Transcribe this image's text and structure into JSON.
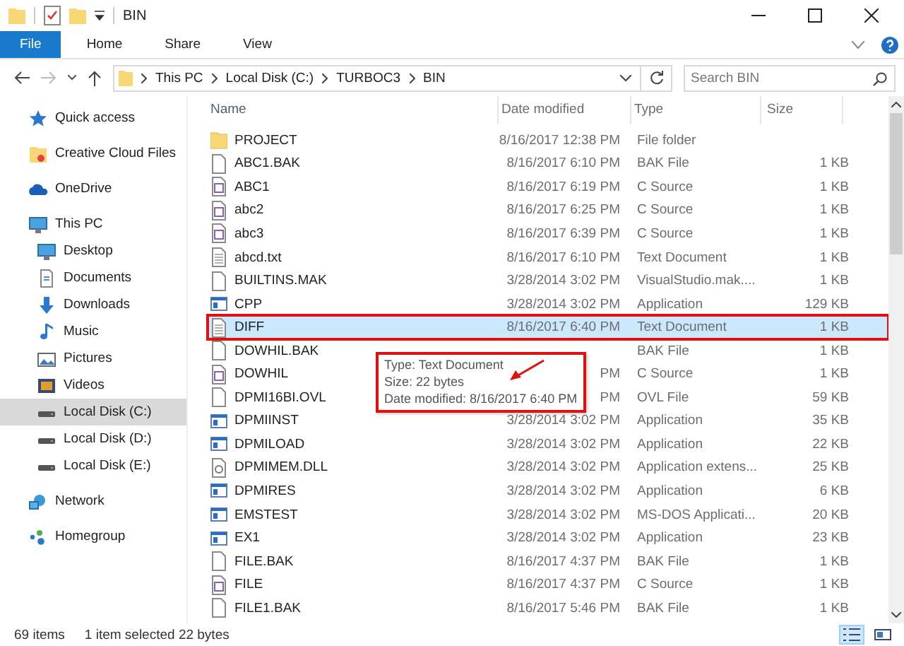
{
  "window": {
    "title": "BIN"
  },
  "ribbon": {
    "tabs": [
      {
        "label": "File",
        "selected": true
      },
      {
        "label": "Home",
        "selected": false
      },
      {
        "label": "Share",
        "selected": false
      },
      {
        "label": "View",
        "selected": false
      }
    ]
  },
  "address": {
    "crumbs": [
      "This PC",
      "Local Disk (C:)",
      "TURBOC3",
      "BIN"
    ],
    "search": {
      "placeholder": "Search BIN"
    }
  },
  "sidebar": {
    "items": [
      {
        "label": "Quick access",
        "kind": "star",
        "selected": false
      },
      {
        "label": "Creative Cloud Files",
        "kind": "cloudfolder",
        "selected": false
      },
      {
        "label": "OneDrive",
        "kind": "cloud",
        "selected": false
      },
      {
        "label": "This PC",
        "kind": "pc",
        "selected": false,
        "children": [
          {
            "label": "Desktop",
            "kind": "desktop",
            "selected": false
          },
          {
            "label": "Documents",
            "kind": "docs",
            "selected": false
          },
          {
            "label": "Downloads",
            "kind": "download",
            "selected": false
          },
          {
            "label": "Music",
            "kind": "music",
            "selected": false
          },
          {
            "label": "Pictures",
            "kind": "pictures",
            "selected": false
          },
          {
            "label": "Videos",
            "kind": "videos",
            "selected": false
          },
          {
            "label": "Local Disk (C:)",
            "kind": "drive",
            "selected": true
          },
          {
            "label": "Local Disk (D:)",
            "kind": "drive",
            "selected": false
          },
          {
            "label": "Local Disk (E:)",
            "kind": "drive",
            "selected": false
          }
        ]
      },
      {
        "label": "Network",
        "kind": "network",
        "selected": false
      },
      {
        "label": "Homegroup",
        "kind": "homegroup",
        "selected": false
      }
    ]
  },
  "table": {
    "columns": [
      "Name",
      "Date modified",
      "Type",
      "Size"
    ],
    "rows": [
      {
        "name": "PROJECT",
        "date": "8/16/2017 12:38 PM",
        "type": "File folder",
        "kind": "folder",
        "selected": false
      },
      {
        "name": "ABC1.BAK",
        "date": "8/16/2017 6:10 PM",
        "type": "BAK File",
        "size": "1 KB",
        "kind": "blank",
        "selected": false
      },
      {
        "name": "ABC1",
        "date": "8/16/2017 6:19 PM",
        "type": "C Source",
        "size": "1 KB",
        "kind": "source",
        "selected": false
      },
      {
        "name": "abc2",
        "date": "8/16/2017 6:25 PM",
        "type": "C Source",
        "size": "1 KB",
        "kind": "source",
        "selected": false
      },
      {
        "name": "abc3",
        "date": "8/16/2017 6:39 PM",
        "type": "C Source",
        "size": "1 KB",
        "kind": "source",
        "selected": false
      },
      {
        "name": "abcd.txt",
        "date": "8/16/2017 6:10 PM",
        "type": "Text Document",
        "size": "1 KB",
        "kind": "text",
        "selected": false
      },
      {
        "name": "BUILTINS.MAK",
        "date": "3/28/2014 3:02 PM",
        "type": "VisualStudio.mak....",
        "size": "1 KB",
        "kind": "blank",
        "selected": false
      },
      {
        "name": "CPP",
        "date": "3/28/2014 3:02 PM",
        "type": "Application",
        "size": "129 KB",
        "kind": "app",
        "selected": false
      },
      {
        "name": "DIFF",
        "date": "8/16/2017 6:40 PM",
        "type": "Text Document",
        "size": "1 KB",
        "kind": "text",
        "selected": true
      },
      {
        "name": "DOWHIL.BAK",
        "type": "BAK File",
        "size": "1 KB",
        "kind": "blank",
        "selected": false
      },
      {
        "name": "DOWHIL",
        "date": "PM",
        "type": "C Source",
        "size": "1 KB",
        "kind": "source",
        "selected": false
      },
      {
        "name": "DPMI16BI.OVL",
        "date": "PM",
        "type": "OVL File",
        "size": "59 KB",
        "kind": "blank",
        "selected": false
      },
      {
        "name": "DPMIINST",
        "date": "3/28/2014 3:02 PM",
        "type": "Application",
        "size": "35 KB",
        "kind": "app",
        "selected": false
      },
      {
        "name": "DPMILOAD",
        "date": "3/28/2014 3:02 PM",
        "type": "Application",
        "size": "22 KB",
        "kind": "app",
        "selected": false
      },
      {
        "name": "DPMIMEM.DLL",
        "date": "3/28/2014 3:02 PM",
        "type": "Application extens...",
        "size": "25 KB",
        "kind": "dll",
        "selected": false
      },
      {
        "name": "DPMIRES",
        "date": "3/28/2014 3:02 PM",
        "type": "Application",
        "size": "6 KB",
        "kind": "app",
        "selected": false
      },
      {
        "name": "EMSTEST",
        "date": "3/28/2014 3:02 PM",
        "type": "MS-DOS Applicati...",
        "size": "20 KB",
        "kind": "app",
        "selected": false
      },
      {
        "name": "EX1",
        "date": "3/28/2014 3:02 PM",
        "type": "Application",
        "size": "23 KB",
        "kind": "app",
        "selected": false
      },
      {
        "name": "FILE.BAK",
        "date": "8/16/2017 4:37 PM",
        "type": "BAK File",
        "size": "1 KB",
        "kind": "blank",
        "selected": false
      },
      {
        "name": "FILE",
        "date": "8/16/2017 4:37 PM",
        "type": "C Source",
        "size": "1 KB",
        "kind": "source",
        "selected": false
      },
      {
        "name": "FILE1.BAK",
        "date": "8/16/2017 5:46 PM",
        "type": "BAK File",
        "size": "1 KB",
        "kind": "blank",
        "selected": false
      }
    ]
  },
  "tooltip": {
    "lines": [
      "Type: Text Document",
      "Size: 22 bytes",
      "Date modified: 8/16/2017 6:40 PM"
    ]
  },
  "status_bar": {
    "items": [
      "69 items",
      "1 item selected  22 bytes"
    ],
    "views": [
      {
        "kind": "details",
        "selected": true
      },
      {
        "kind": "tiles",
        "selected": false
      }
    ]
  }
}
